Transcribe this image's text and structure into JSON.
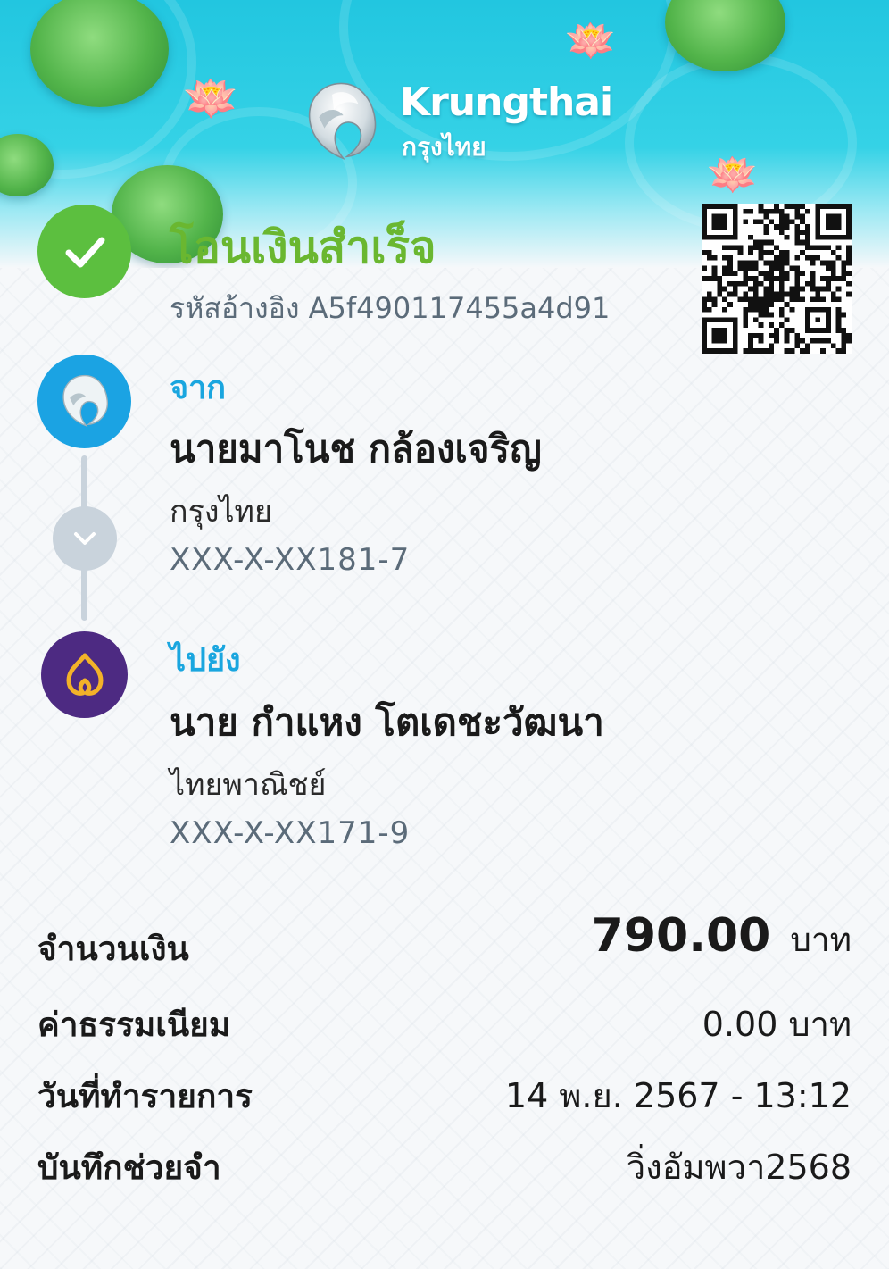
{
  "brand": {
    "name_en": "Krungthai",
    "name_th": "กรุงไทย"
  },
  "status": {
    "title": "โอนเงินสำเร็จ",
    "ref_label": "รหัสอ้างอิง",
    "ref_code": "A5f490117455a4d91"
  },
  "from": {
    "label": "จาก",
    "name": "นายมาโนช กล้องเจริญ",
    "bank": "กรุงไทย",
    "account": "XXX-X-XX181-7"
  },
  "to": {
    "label": "ไปยัง",
    "name": "นาย กำแหง โตเดชะวัฒนา",
    "bank": "ไทยพาณิชย์",
    "account": "XXX-X-XX171-9"
  },
  "details": {
    "amount_label": "จำนวนเงิน",
    "amount_value": "790.00",
    "amount_unit": "บาท",
    "fee_label": "ค่าธรรมเนียม",
    "fee_value": "0.00 บาท",
    "date_label": "วันที่ทำรายการ",
    "date_value": "14 พ.ย. 2567 - 13:12",
    "memo_label": "บันทึกช่วยจำ",
    "memo_value": "วิ่งอัมพวา2568"
  },
  "colors": {
    "success": "#6ab730",
    "accent_blue": "#1aa6df",
    "scb_purple": "#4d2a82",
    "banner": "#22c6e0"
  },
  "icons": {
    "status": "check-icon",
    "from": "krungthai-bird-icon",
    "to": "scb-logo-icon",
    "connector": "chevron-down-icon"
  }
}
